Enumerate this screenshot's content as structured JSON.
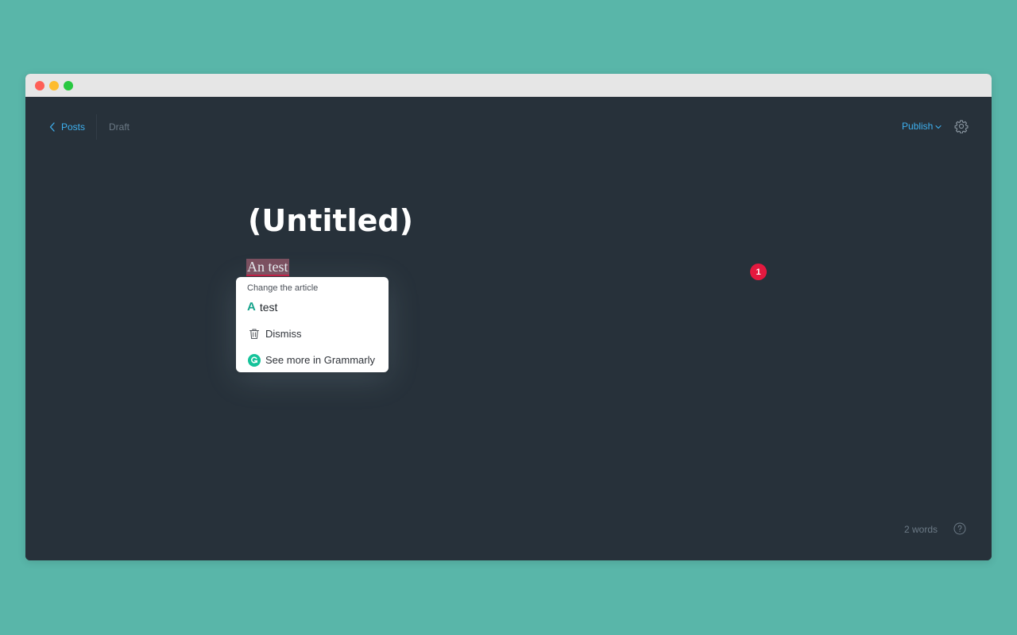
{
  "nav": {
    "back_label": "Posts",
    "status": "Draft",
    "publish_label": "Publish"
  },
  "post": {
    "title": "(Untitled)",
    "body_text": "An test"
  },
  "grammarly": {
    "issue_count": "1",
    "hint": "Change the article",
    "suggested_article": "A",
    "suggested_word": "test",
    "dismiss_label": "Dismiss",
    "more_label": "See more in Grammarly"
  },
  "footer": {
    "word_count": "2 words"
  },
  "icons": {
    "back": "chevron-left-icon",
    "publish_dropdown": "chevron-down-icon",
    "settings": "gear-icon",
    "help": "help-circle-icon",
    "dismiss": "trash-icon",
    "grammarly": "grammarly-logo-icon"
  },
  "colors": {
    "background": "#59b6a9",
    "editor": "#27313a",
    "accent": "#3eb0ef",
    "error": "#e4193f",
    "grammarly": "#15c39a"
  }
}
